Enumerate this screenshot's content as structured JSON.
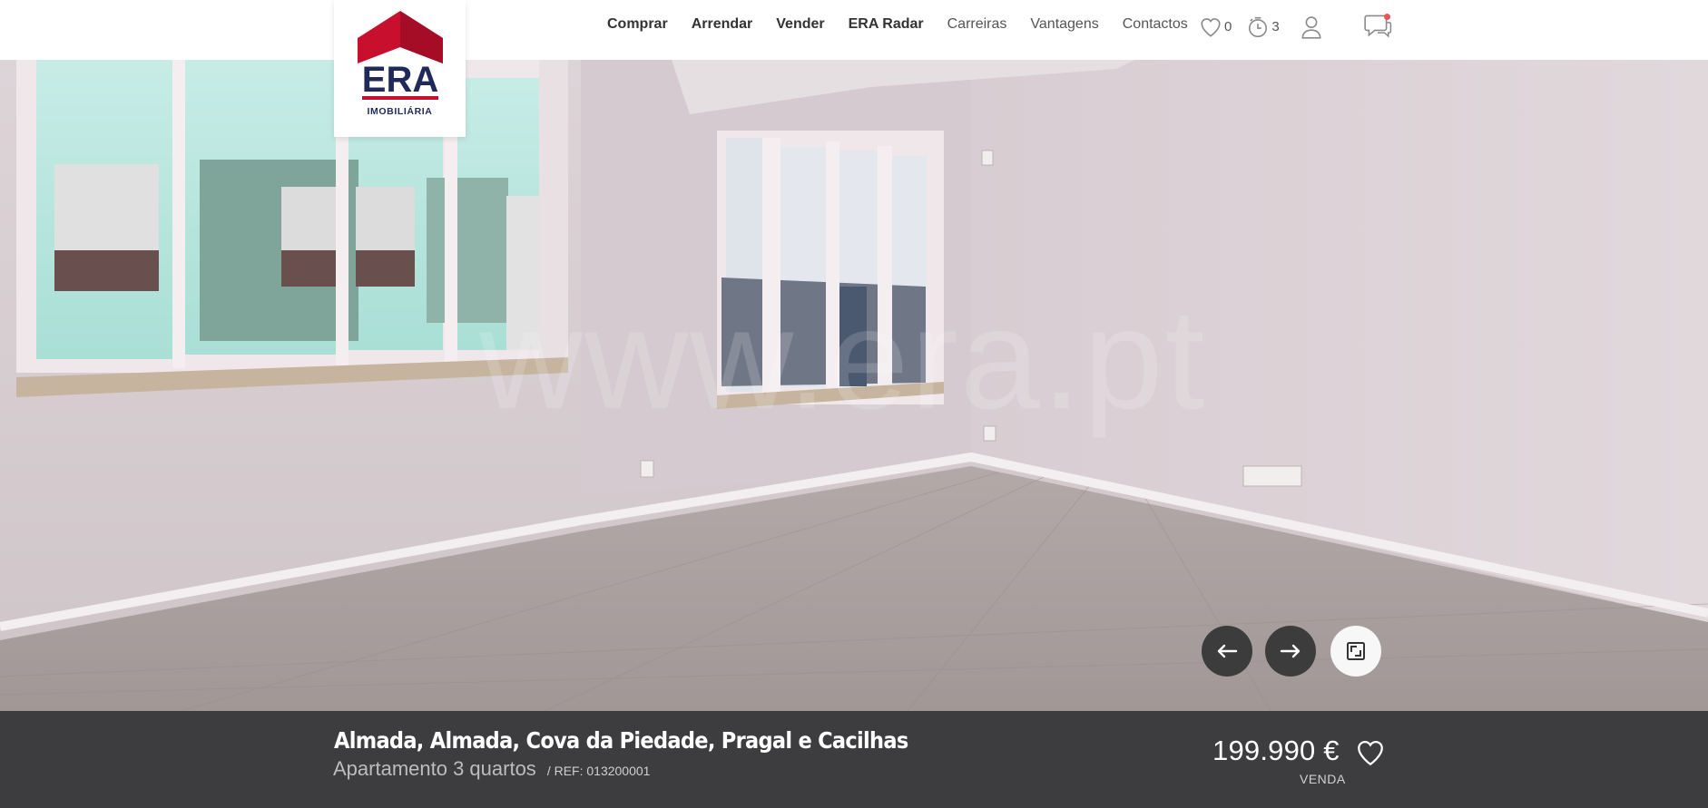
{
  "header": {
    "logo": {
      "brand": "ERA",
      "tagline": "IMOBILIÁRIA",
      "colors": {
        "roof": "#c8102e",
        "text": "#1f2a5a",
        "bar": "#c8102e"
      }
    },
    "nav": [
      {
        "label": "Comprar",
        "weight": "bold"
      },
      {
        "label": "Arrendar",
        "weight": "bold"
      },
      {
        "label": "Vender",
        "weight": "bold"
      },
      {
        "label": "ERA Radar",
        "weight": "bold"
      },
      {
        "label": "Carreiras",
        "weight": "light"
      },
      {
        "label": "Vantagens",
        "weight": "light"
      },
      {
        "label": "Contactos",
        "weight": "light"
      }
    ],
    "favorites": {
      "icon": "heart-icon",
      "count": "0"
    },
    "history": {
      "icon": "clock-icon",
      "count": "3"
    },
    "account": {
      "icon": "user-icon"
    },
    "chat": {
      "icon": "chat-icon",
      "notification": true
    }
  },
  "gallery": {
    "watermark": "www.era.pt",
    "controls": {
      "prev": "arrow-left-icon",
      "next": "arrow-right-icon",
      "fullscreen": "fullscreen-icon"
    }
  },
  "listing": {
    "location": "Almada, Almada, Cova da Piedade, Pragal e Cacilhas",
    "property_type": "Apartamento 3 quartos",
    "ref": "/ REF: 013200001",
    "price": "199.990 €",
    "transaction": "VENDA"
  }
}
